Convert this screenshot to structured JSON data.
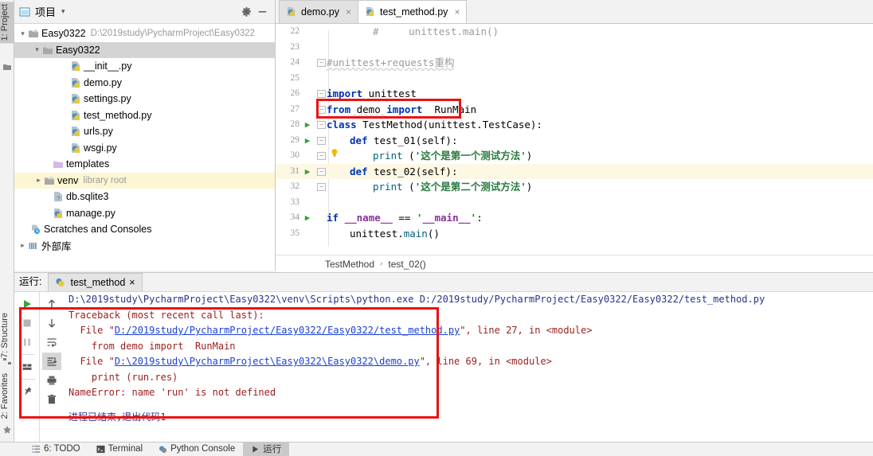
{
  "left_rail": {
    "tabs": [
      {
        "label": "1: Project",
        "icon": "project-icon",
        "active": true
      },
      {
        "label": "7: Structure",
        "icon": "structure-icon",
        "active": false
      },
      {
        "label": "2: Favorites",
        "icon": "star-icon",
        "active": false
      }
    ]
  },
  "project_panel": {
    "title": "项目",
    "caret": "▾",
    "gear_icon": "gear-icon",
    "minimize_icon": "minimize-icon",
    "tree": [
      {
        "indent": 0,
        "arrow": "▾",
        "icon": "folder-module",
        "label": "Easy0322",
        "sub": "D:\\2019study\\PycharmProject\\Easy0322",
        "state": ""
      },
      {
        "indent": 1,
        "arrow": "▾",
        "icon": "folder-module",
        "label": "Easy0322",
        "sub": "",
        "state": "sel-gray"
      },
      {
        "indent": 2,
        "arrow": "",
        "icon": "python-file",
        "label": "__init__.py",
        "sub": "",
        "state": ""
      },
      {
        "indent": 2,
        "arrow": "",
        "icon": "python-file",
        "label": "demo.py",
        "sub": "",
        "state": ""
      },
      {
        "indent": 2,
        "arrow": "",
        "icon": "python-file",
        "label": "settings.py",
        "sub": "",
        "state": ""
      },
      {
        "indent": 2,
        "arrow": "",
        "icon": "python-file",
        "label": "test_method.py",
        "sub": "",
        "state": ""
      },
      {
        "indent": 2,
        "arrow": "",
        "icon": "python-file",
        "label": "urls.py",
        "sub": "",
        "state": ""
      },
      {
        "indent": 2,
        "arrow": "",
        "icon": "python-file",
        "label": "wsgi.py",
        "sub": "",
        "state": ""
      },
      {
        "indent": 1,
        "arrow": "",
        "icon": "folder-purple",
        "label": "templates",
        "sub": "",
        "state": ""
      },
      {
        "indent": 1,
        "arrow": "▸",
        "icon": "folder-module",
        "label": "venv",
        "sub": "library root",
        "state": "sel-yellow"
      },
      {
        "indent": 1,
        "arrow": "",
        "icon": "sqlite-file",
        "label": "db.sqlite3",
        "sub": "",
        "state": ""
      },
      {
        "indent": 1,
        "arrow": "",
        "icon": "python-file",
        "label": "manage.py",
        "sub": "",
        "state": ""
      },
      {
        "indent": 0,
        "arrow": "",
        "icon": "scratches-icon",
        "label": "Scratches and Consoles",
        "sub": "",
        "state": ""
      },
      {
        "indent": 0,
        "arrow": "▸",
        "icon": "library-icon",
        "label": "外部库",
        "sub": "",
        "state": ""
      }
    ]
  },
  "editor_tabs": [
    {
      "label": "demo.py",
      "icon": "python-file",
      "active": false,
      "close": "×"
    },
    {
      "label": "test_method.py",
      "icon": "python-file",
      "active": true,
      "close": "×"
    }
  ],
  "editor": {
    "lines": [
      {
        "n": "22",
        "run": false,
        "fold": "",
        "bulb": false,
        "hl": false,
        "indent": 2,
        "segs": [
          {
            "t": "#     unittest.main()",
            "c": "cm"
          }
        ]
      },
      {
        "n": "23",
        "run": false,
        "fold": "",
        "bulb": false,
        "hl": false,
        "indent": 0,
        "segs": []
      },
      {
        "n": "24",
        "run": false,
        "fold": "−",
        "bulb": false,
        "hl": false,
        "indent": 0,
        "segs": [
          {
            "t": "#unittest+requests重构",
            "c": "cm squig"
          }
        ]
      },
      {
        "n": "25",
        "run": false,
        "fold": "",
        "bulb": false,
        "hl": false,
        "indent": 0,
        "segs": []
      },
      {
        "n": "26",
        "run": false,
        "fold": "−",
        "bulb": false,
        "hl": false,
        "indent": 0,
        "segs": [
          {
            "t": "import",
            "c": "kw"
          },
          {
            "t": " unittest",
            "c": "pl"
          }
        ]
      },
      {
        "n": "27",
        "run": false,
        "fold": "−",
        "bulb": false,
        "hl": false,
        "indent": 0,
        "segs": [
          {
            "t": "from",
            "c": "kw"
          },
          {
            "t": " demo ",
            "c": "pl squig"
          },
          {
            "t": "import",
            "c": "kw"
          },
          {
            "t": "  RunMain",
            "c": "pl"
          }
        ]
      },
      {
        "n": "28",
        "run": true,
        "fold": "−",
        "bulb": false,
        "hl": false,
        "indent": 0,
        "segs": [
          {
            "t": "class",
            "c": "kw"
          },
          {
            "t": " ",
            "c": "pl"
          },
          {
            "t": "TestMethod",
            "c": "pl"
          },
          {
            "t": "(unittest.TestCase):",
            "c": "pl"
          }
        ]
      },
      {
        "n": "29",
        "run": true,
        "fold": "−",
        "bulb": false,
        "hl": false,
        "indent": 1,
        "segs": [
          {
            "t": "def",
            "c": "kw"
          },
          {
            "t": " ",
            "c": "pl"
          },
          {
            "t": "test_01",
            "c": "pl"
          },
          {
            "t": "(self):",
            "c": "pl"
          }
        ]
      },
      {
        "n": "30",
        "run": false,
        "fold": "−",
        "bulb": true,
        "hl": false,
        "indent": 2,
        "segs": [
          {
            "t": "print",
            "c": "fn"
          },
          {
            "t": " (",
            "c": "pl"
          },
          {
            "t": "'这个是第一个测试方法'",
            "c": "str"
          },
          {
            "t": ")",
            "c": "pl"
          }
        ]
      },
      {
        "n": "31",
        "run": true,
        "fold": "−",
        "bulb": false,
        "hl": true,
        "indent": 1,
        "segs": [
          {
            "t": "def",
            "c": "kw"
          },
          {
            "t": " ",
            "c": "pl"
          },
          {
            "t": "test_02",
            "c": "pl"
          },
          {
            "t": "(self):",
            "c": "pl"
          }
        ]
      },
      {
        "n": "32",
        "run": false,
        "fold": "−",
        "bulb": false,
        "hl": false,
        "indent": 2,
        "segs": [
          {
            "t": "print",
            "c": "fn"
          },
          {
            "t": " (",
            "c": "pl"
          },
          {
            "t": "'这个是第二个测试方法'",
            "c": "str"
          },
          {
            "t": ")",
            "c": "pl"
          }
        ]
      },
      {
        "n": "33",
        "run": false,
        "fold": "",
        "bulb": false,
        "hl": false,
        "indent": 0,
        "segs": []
      },
      {
        "n": "34",
        "run": true,
        "fold": "",
        "bulb": false,
        "hl": false,
        "indent": 0,
        "segs": [
          {
            "t": "if",
            "c": "kw"
          },
          {
            "t": " ",
            "c": "pl"
          },
          {
            "t": "__name__",
            "c": "dunder"
          },
          {
            "t": " == ",
            "c": "pl"
          },
          {
            "t": "'",
            "c": "str"
          },
          {
            "t": "__main__",
            "c": "dunder"
          },
          {
            "t": "'",
            "c": "str"
          },
          {
            "t": ":",
            "c": "pl"
          }
        ]
      },
      {
        "n": "35",
        "run": false,
        "fold": "",
        "bulb": false,
        "hl": false,
        "indent": 1,
        "segs": [
          {
            "t": "unittest.",
            "c": "pl"
          },
          {
            "t": "main",
            "c": "fn"
          },
          {
            "t": "()",
            "c": "pl"
          }
        ]
      }
    ],
    "highlight_box": {
      "label": "import-highlight-box"
    }
  },
  "breadcrumb": {
    "class_name": "TestMethod",
    "separator": "›",
    "method_name": "test_02()"
  },
  "run_panel": {
    "title": "运行:",
    "tab_label": "test_method",
    "tab_close": "×",
    "toolbar_left": [
      {
        "name": "rerun-button",
        "icon": "play-icon"
      },
      {
        "name": "stop-button",
        "icon": "stop-icon"
      },
      {
        "name": "pause-button",
        "icon": "pause-icon"
      },
      {
        "name": "layout-button",
        "icon": "layout-icon"
      },
      {
        "name": "pin-button",
        "icon": "pin-icon"
      }
    ],
    "toolbar_right": [
      {
        "name": "up-button",
        "icon": "arrow-up-icon"
      },
      {
        "name": "down-button",
        "icon": "arrow-down-icon"
      },
      {
        "name": "soft-wrap-button",
        "icon": "wrap-icon"
      },
      {
        "name": "scroll-to-end-button",
        "icon": "scroll-end-icon",
        "on": true
      },
      {
        "name": "print-button",
        "icon": "print-icon"
      },
      {
        "name": "clear-all-button",
        "icon": "trash-icon"
      }
    ],
    "console": {
      "command": "D:\\2019study\\PycharmProject\\Easy0322\\venv\\Scripts\\python.exe D:/2019study/PycharmProject/Easy0322/Easy0322/test_method.py",
      "traceback_header": "Traceback (most recent call last):",
      "frames": [
        {
          "prefix": "  File \"",
          "path": "D:/2019study/PycharmProject/Easy0322/Easy0322/test_method.py",
          "suffix": "\", line 27, in <module>",
          "code": "    from demo import  RunMain"
        },
        {
          "prefix": "  File \"",
          "path": "D:\\2019study\\PycharmProject\\Easy0322\\Easy0322\\demo.py",
          "suffix": "\", line 69, in <module>",
          "code": "    print (run.res)"
        }
      ],
      "error": "NameError: name 'run' is not defined",
      "exit_message": "进程已结束,退出代码1"
    }
  },
  "status_bar": {
    "items": [
      {
        "label": "6: TODO",
        "icon": "todo-icon",
        "active": false
      },
      {
        "label": "Terminal",
        "icon": "terminal-icon",
        "active": false
      },
      {
        "label": "Python Console",
        "icon": "python-console-icon",
        "active": false
      },
      {
        "label": "运行",
        "icon": "play-icon",
        "active": true
      }
    ]
  },
  "colors": {
    "annotation_red": "#ee1111",
    "link_blue": "#1a3fd4",
    "error_red": "#9b1d1d",
    "console_blue": "#27348b",
    "keyword_blue": "#0033b3",
    "string_green": "#2a7a3f",
    "highlight_yellow": "#fcf8e3"
  }
}
